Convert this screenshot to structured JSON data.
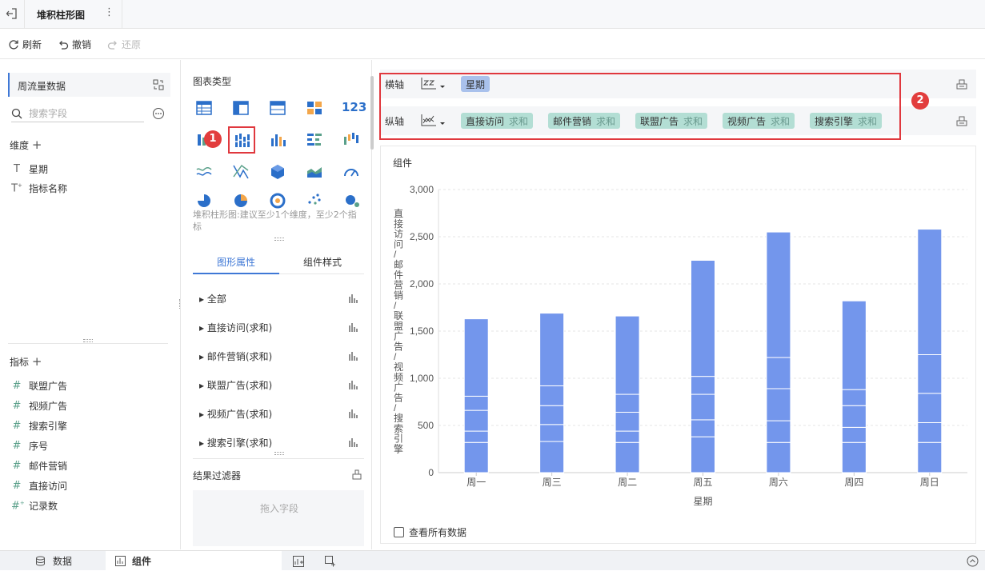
{
  "topbar": {
    "title": "堆积柱形图"
  },
  "toolbar": {
    "refresh": "刷新",
    "undo": "撤销",
    "redo": "还原"
  },
  "left": {
    "dataset": "周流量数据",
    "search_placeholder": "搜索字段",
    "dimension_header": "维度",
    "dimensions": [
      {
        "icon": "text-icon",
        "label": "星期"
      },
      {
        "icon": "text-calc-icon",
        "label": "指标名称"
      }
    ],
    "measure_header": "指标",
    "measures": [
      {
        "icon": "number-icon",
        "label": "联盟广告"
      },
      {
        "icon": "number-icon",
        "label": "视频广告"
      },
      {
        "icon": "number-icon",
        "label": "搜索引擎"
      },
      {
        "icon": "number-icon",
        "label": "序号"
      },
      {
        "icon": "number-icon",
        "label": "邮件营销"
      },
      {
        "icon": "number-icon",
        "label": "直接访问"
      },
      {
        "icon": "number-calc-icon",
        "label": "记录数"
      }
    ]
  },
  "middle": {
    "chart_type_header": "图表类型",
    "hint": "堆积柱形图:建议至少1个维度，至少2个指标",
    "tabs": [
      "图形属性",
      "组件样式"
    ],
    "properties": [
      "全部",
      "直接访问(求和)",
      "邮件营销(求和)",
      "联盟广告(求和)",
      "视频广告(求和)",
      "搜索引擎(求和)"
    ],
    "filter_header": "结果过滤器",
    "filter_placeholder": "拖入字段"
  },
  "axes": {
    "x_label": "横轴",
    "y_label": "纵轴",
    "x_fields": [
      {
        "name": "星期"
      }
    ],
    "y_fields": [
      {
        "name": "直接访问",
        "agg": "求和"
      },
      {
        "name": "邮件营销",
        "agg": "求和"
      },
      {
        "name": "联盟广告",
        "agg": "求和"
      },
      {
        "name": "视频广告",
        "agg": "求和"
      },
      {
        "name": "搜索引擎",
        "agg": "求和"
      }
    ]
  },
  "annotations": {
    "badge1": "1",
    "badge2": "2"
  },
  "chart": {
    "component_title": "组件",
    "view_all": "查看所有数据"
  },
  "chart_data": {
    "type": "bar",
    "stacked": true,
    "categories": [
      "周一",
      "周三",
      "周二",
      "周五",
      "周六",
      "周四",
      "周日"
    ],
    "series": [
      {
        "name": "直接访问",
        "values": [
          320,
          330,
          320,
          380,
          320,
          320,
          320
        ]
      },
      {
        "name": "邮件营销",
        "values": [
          120,
          180,
          120,
          180,
          230,
          160,
          210
        ]
      },
      {
        "name": "联盟广告",
        "values": [
          220,
          200,
          200,
          270,
          340,
          230,
          310
        ]
      },
      {
        "name": "视频广告",
        "values": [
          150,
          210,
          190,
          190,
          330,
          170,
          410
        ]
      },
      {
        "name": "搜索引擎",
        "values": [
          820,
          770,
          830,
          1230,
          1330,
          940,
          1330
        ]
      }
    ],
    "xlabel": "星期",
    "ylabel": "直接访问/邮件营销/联盟广告/视频广告/搜索引擎",
    "ylim": [
      0,
      3000
    ],
    "yticks": [
      "0",
      "500",
      "1,000",
      "1,500",
      "2,000",
      "2,500",
      "3,000"
    ],
    "bar_color": "#7396ec",
    "grid": true
  },
  "bottom": {
    "tabs": [
      "数据",
      "组件"
    ]
  },
  "colors": {
    "accent": "#3f78d6",
    "x_chip": "#a9c1ec",
    "y_chip": "#b3ded4",
    "red": "#e0383e"
  }
}
